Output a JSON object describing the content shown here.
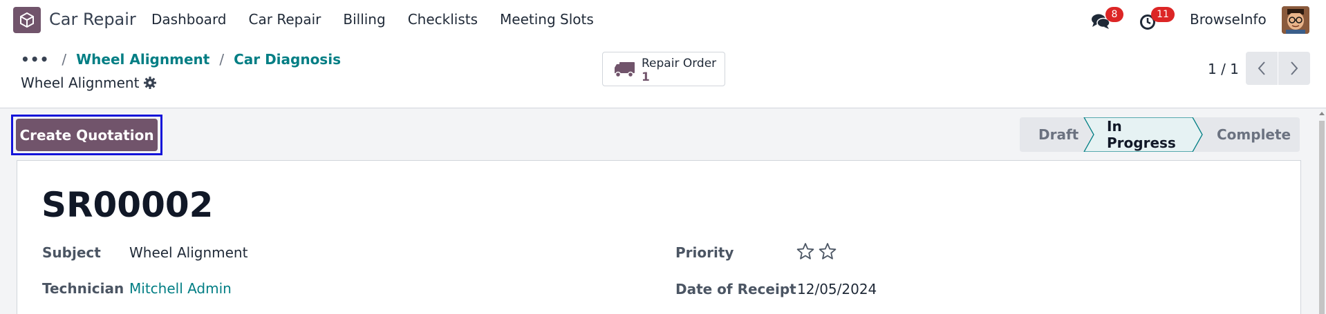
{
  "navbar": {
    "app_name": "Car Repair",
    "menu": [
      "Dashboard",
      "Car Repair",
      "Billing",
      "Checklists",
      "Meeting Slots"
    ],
    "messages_count": "8",
    "activities_count": "11",
    "company": "BrowseInfo"
  },
  "breadcrumb": {
    "items": [
      "Wheel Alignment",
      "Car Diagnosis"
    ]
  },
  "record": {
    "title": "Wheel Alignment"
  },
  "smart_button": {
    "label": "Repair Order",
    "value": "1"
  },
  "pager": {
    "text": "1 / 1"
  },
  "actions": {
    "create_quotation": "Create Quotation"
  },
  "statusbar": {
    "stages": [
      "Draft",
      "In Progress",
      "Complete"
    ],
    "active": "In Progress"
  },
  "form": {
    "reference": "SR00002",
    "subject_label": "Subject",
    "subject_value": "Wheel Alignment",
    "technician_label": "Technician",
    "technician_value": "Mitchell Admin",
    "priority_label": "Priority",
    "priority_stars": 0,
    "priority_max": 2,
    "date_label": "Date of Receipt",
    "date_value": "12/05/2024"
  },
  "colors": {
    "brand": "#71546b",
    "link": "#017e84",
    "badge": "#dc2626",
    "active_stage": "#e6f2f3"
  }
}
